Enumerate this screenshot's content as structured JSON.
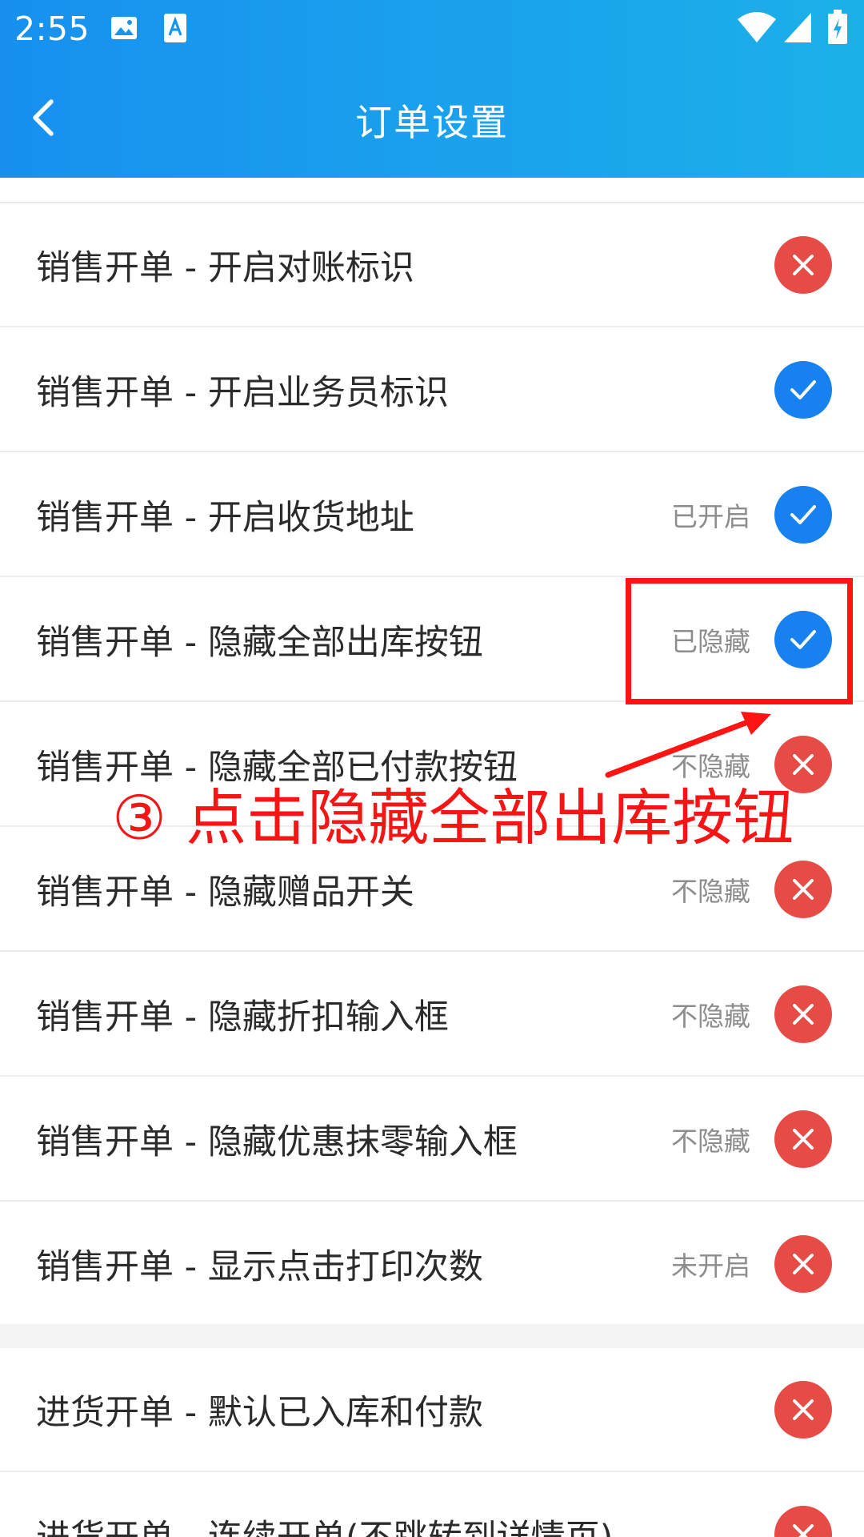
{
  "status_bar": {
    "time": "2:55",
    "icons": [
      "image-icon",
      "app-notification-icon",
      "wifi-icon",
      "signal-icon",
      "battery-charging-icon"
    ]
  },
  "header": {
    "title": "订单设置",
    "back_icon": "back-arrow-icon"
  },
  "colors": {
    "header_start": "#1790ee",
    "header_end": "#1bb0e8",
    "toggle_on": "#1781f0",
    "toggle_off": "#e74b45",
    "annotation": "#ff1414"
  },
  "settings": [
    {
      "label": "销售开单 - 开启对账标识",
      "status": "",
      "enabled": false
    },
    {
      "label": "销售开单 - 开启业务员标识",
      "status": "",
      "enabled": true
    },
    {
      "label": "销售开单 - 开启收货地址",
      "status": "已开启",
      "enabled": true
    },
    {
      "label": "销售开单 - 隐藏全部出库按钮",
      "status": "已隐藏",
      "enabled": true
    },
    {
      "label": "销售开单 - 隐藏全部已付款按钮",
      "status": "不隐藏",
      "enabled": false
    },
    {
      "label": "销售开单 - 隐藏赠品开关",
      "status": "不隐藏",
      "enabled": false
    },
    {
      "label": "销售开单 - 隐藏折扣输入框",
      "status": "不隐藏",
      "enabled": false
    },
    {
      "label": "销售开单 - 隐藏优惠抹零输入框",
      "status": "不隐藏",
      "enabled": false
    },
    {
      "label": "销售开单 - 显示点击打印次数",
      "status": "未开启",
      "enabled": false
    }
  ],
  "purchase_settings": [
    {
      "label": "进货开单 - 默认已入库和付款",
      "status": "",
      "enabled": false
    },
    {
      "label": "进货开单 - 连续开单(不跳转到详情页)",
      "status": "",
      "enabled": false
    }
  ],
  "annotation": {
    "text": "③ 点击隐藏全部出库按钮"
  }
}
